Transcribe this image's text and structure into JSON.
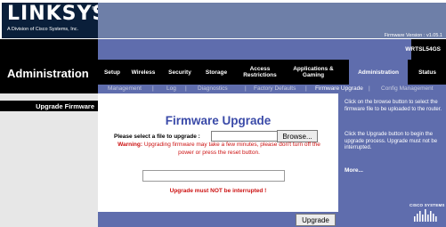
{
  "header": {
    "logo": "LINKSYS",
    "logo_reg": "®",
    "logo_tagline": "A Division of Cisco Systems, Inc.",
    "firmware_version": "Firmware Version : v1.05.1",
    "model": "WRTSL54GS"
  },
  "nav": {
    "section_title": "Administration",
    "tabs": [
      {
        "label": "Setup"
      },
      {
        "label": "Wireless"
      },
      {
        "label": "Security"
      },
      {
        "label": "Storage"
      },
      {
        "label": "Access Restrictions"
      },
      {
        "label": "Applications & Gaming"
      },
      {
        "label": "Administration"
      },
      {
        "label": "Status"
      }
    ]
  },
  "subnav": {
    "items": [
      {
        "label": "Management"
      },
      {
        "label": "Log"
      },
      {
        "label": "Diagnostics"
      },
      {
        "label": "Factory Defaults"
      },
      {
        "label": "Firmware Upgrade"
      },
      {
        "label": "Config Management"
      }
    ],
    "separator": "|"
  },
  "left": {
    "heading": "Upgrade Firmware"
  },
  "main": {
    "title": "Firmware Upgrade",
    "file_label": "Please select a file to upgrade :",
    "file_value": "",
    "browse_label": "Browse...",
    "warning_prefix": "Warning:",
    "warning_text": "Upgrading firmware may take a few minutes, please don't turn off the power or press the reset button.",
    "interrupt_note": "Upgrade must NOT be interrupted !",
    "upgrade_label": "Upgrade"
  },
  "help": {
    "text1": "Click on the browse button to select the firmware file to be uploaded to the router.",
    "text2": "Click the Upgrade button to begin the upgrade process. Upgrade must not be interrupted.",
    "more": "More...",
    "brand": "CISCO SYSTEMS"
  },
  "colors": {
    "accent": "#5f6dad",
    "title_blue": "#3a4aa8",
    "warning_red": "#cc1111"
  }
}
